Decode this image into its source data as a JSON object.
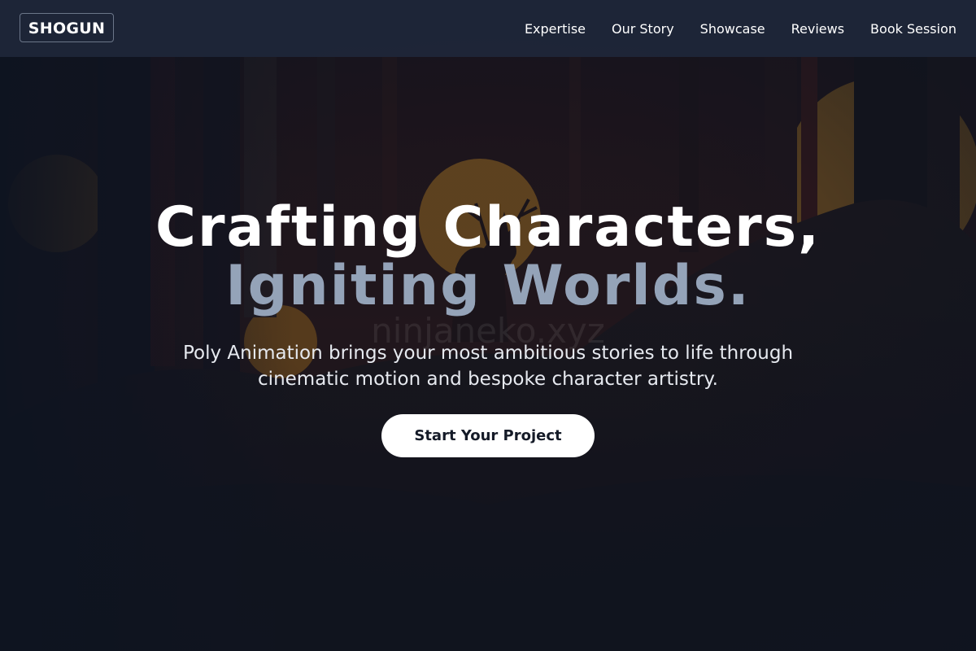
{
  "brand": {
    "logo_text": "SHOGUN"
  },
  "nav": {
    "items": [
      {
        "label": "Expertise"
      },
      {
        "label": "Our Story"
      },
      {
        "label": "Showcase"
      },
      {
        "label": "Reviews"
      },
      {
        "label": "Book Session"
      }
    ]
  },
  "hero": {
    "headline_line1": "Crafting Characters,",
    "headline_line2": "Igniting Worlds.",
    "subtitle_line1": "Poly Animation brings your most ambitious stories to life through",
    "subtitle_line2": "cinematic motion and bespoke character artistry.",
    "cta_label": "Start Your Project",
    "watermark_text": "ninjaneko.xyz"
  },
  "colors": {
    "nav_background": "#1e2738",
    "headline_primary": "#ffffff",
    "headline_accent": "#94a3b8",
    "cta_background": "#ffffff",
    "cta_text": "#151b28",
    "sun": "#d98b1e"
  },
  "background": {
    "scene": "dark forest at dusk with orange suns and a deer silhouette"
  }
}
